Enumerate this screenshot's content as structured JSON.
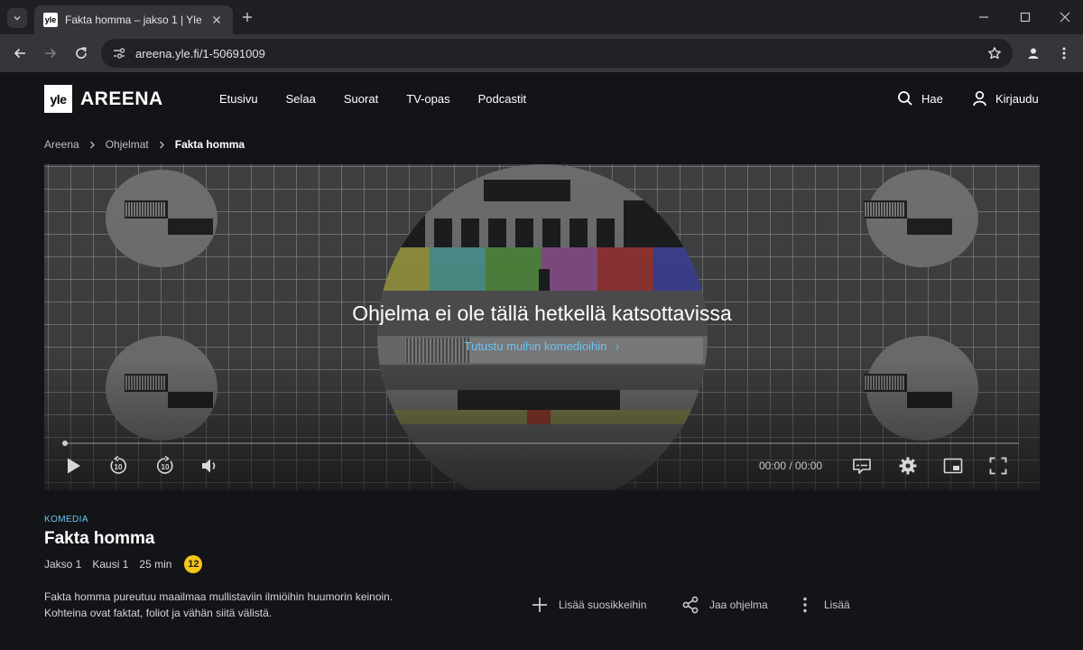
{
  "browser": {
    "tab_title": "Fakta homma – jakso 1 | Yle Areena",
    "favicon_text": "yle",
    "url": "areena.yle.fi/1-50691009",
    "icons": [
      "tab-search-icon",
      "close-icon",
      "plus-icon",
      "minimize-icon",
      "maximize-icon",
      "close-window-icon",
      "back-icon",
      "forward-icon",
      "reload-icon",
      "site-settings-icon",
      "star-icon",
      "profile-icon",
      "menu-dots-icon"
    ]
  },
  "header": {
    "logo_badge": "yle",
    "logo_text": "AREENA",
    "nav": [
      "Etusivu",
      "Selaa",
      "Suorat",
      "TV-opas",
      "Podcastit"
    ],
    "search_label": "Hae",
    "login_label": "Kirjaudu"
  },
  "breadcrumb": {
    "items": [
      "Areena",
      "Ohjelmat"
    ],
    "current": "Fakta homma"
  },
  "player": {
    "message": "Ohjelma ei ole tällä hetkellä katsottavissa",
    "link_label": "Tutustu muihin komedioihin",
    "link_chevron": "›",
    "time": "00:00 / 00:00",
    "progress": 0,
    "skip_seconds": "10"
  },
  "program": {
    "category": "KOMEDIA",
    "title": "Fakta homma",
    "episode": "Jakso 1",
    "season": "Kausi 1",
    "duration": "25 min",
    "age_rating": "12",
    "description_line1": "Fakta homma pureutuu maailmaa mullistaviin ilmiöihin huumorin keinoin.",
    "description_line2": "Kohteina ovat faktat, foliot ja vähän siitä välistä."
  },
  "actions": {
    "favorite": "Lisää suosikkeihin",
    "share": "Jaa ohjelma",
    "more": "Lisää"
  },
  "colors": {
    "accent_blue": "#6cc3f0",
    "age_badge": "#f5c518",
    "background": "#131418"
  }
}
